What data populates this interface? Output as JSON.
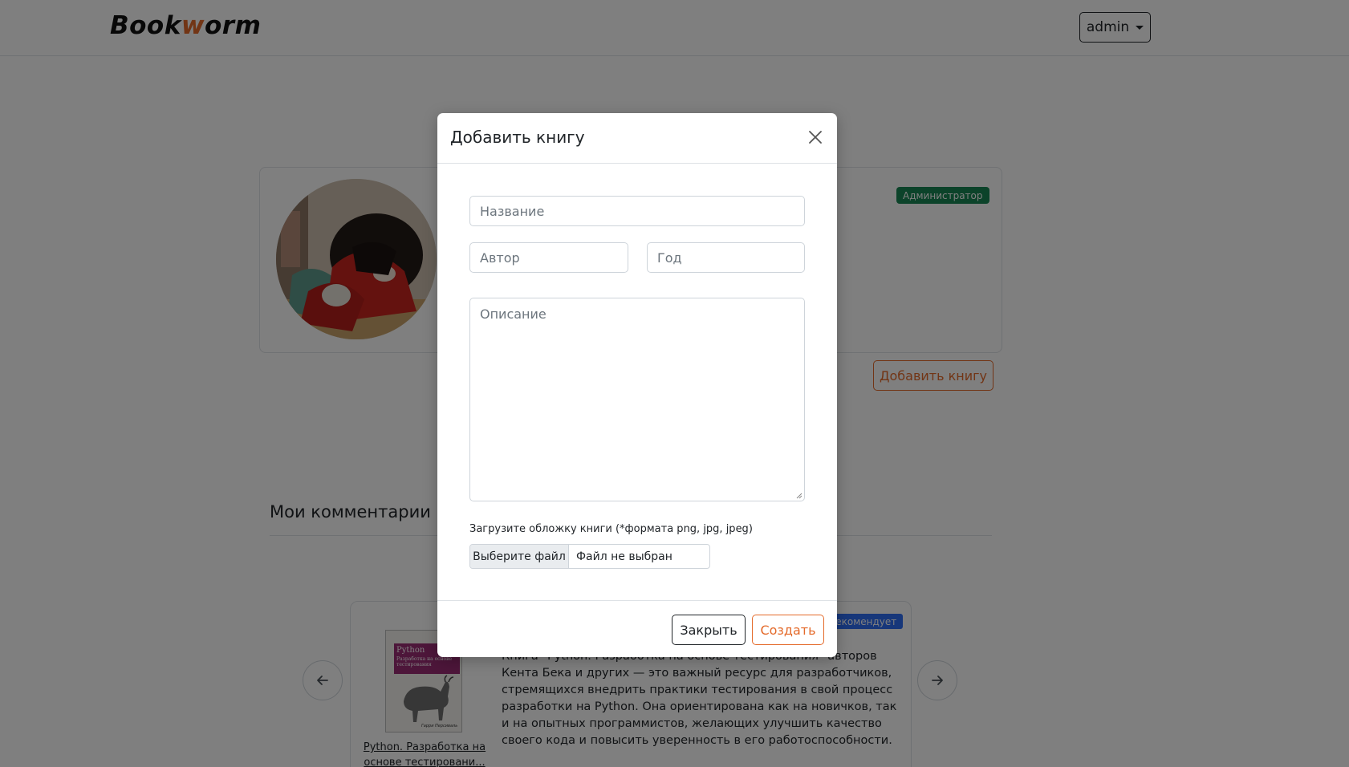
{
  "navbar": {
    "brand_prefix": "Book",
    "brand_accent": "w",
    "brand_suffix": "orm",
    "user_menu": "admin"
  },
  "profile": {
    "role_badge": "Администратор",
    "add_book_label": "Добавить книгу"
  },
  "comments": {
    "title": "Мои комментарии",
    "item": {
      "book_title": "Python. Разработка на основе тестировани...",
      "badge": "Рекомендует",
      "text": "Книга \"Python. Разработка на основе тестирования\" авторов Кента Бека и других — это важный ресурс для разработчиков, стремящихся внедрить практики тестирования в свой процесс разработки на Python. Она ориентирована как на новичков, так и на опытных программистов, желающих улучшить качество своего кода и повысить уверенность в его работоспособности.",
      "cover_title": "Python",
      "cover_subtitle": "Разработка на основе тестирования",
      "cover_author": "Гарри Персиваль"
    }
  },
  "modal": {
    "title": "Добавить книгу",
    "name_placeholder": "Название",
    "author_placeholder": "Автор",
    "year_placeholder": "Год",
    "description_placeholder": "Описание",
    "upload_label": "Загрузите обложку книги (*формата png, jpg, jpeg)",
    "file_button": "Выберите файл",
    "file_status": "Файл не выбран",
    "close_label": "Закрыть",
    "create_label": "Создать"
  },
  "colors": {
    "accent": "#e46a2a",
    "success": "#198754",
    "primary": "#2f6ef5"
  }
}
